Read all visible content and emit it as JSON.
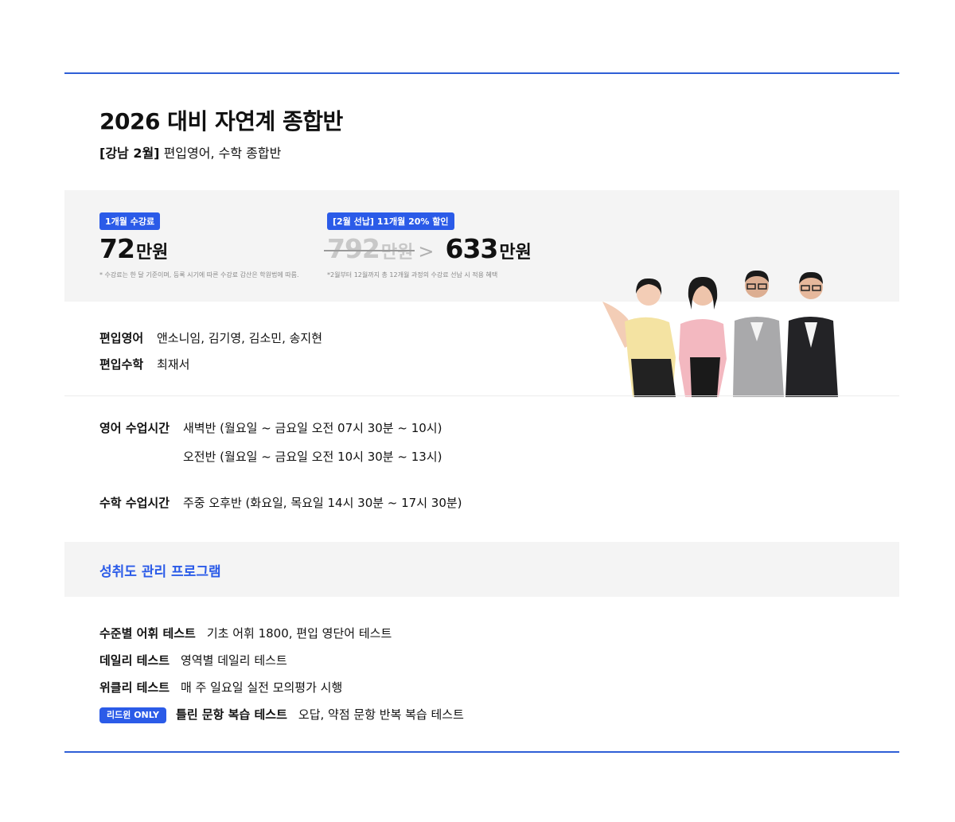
{
  "course": {
    "title": "2026 대비 자연계 종합반",
    "subtitle_prefix": "[강남 2월]",
    "subtitle_rest": " 편입영어, 수학 종합반"
  },
  "price": {
    "monthly": {
      "badge": "1개월 수강료",
      "amount": "72",
      "unit": "만원",
      "note": "* 수강료는 한 달 기준이며, 등록 시기에 따른 수강료 감산은 학원법에 따름."
    },
    "prepay": {
      "badge": "[2월 선납] 11개월 20% 할인",
      "original_amount": "792",
      "original_unit": "만원",
      "arrow": ">",
      "amount": "633",
      "unit": "만원",
      "note": "*2월부터 12월까지 총 12개월 과정의 수강료 선납 시 적용 혜택"
    }
  },
  "teachers": [
    {
      "label": "편입영어",
      "names": "앤소니임, 김기영, 김소민, 송지현"
    },
    {
      "label": "편입수학",
      "names": "최재서"
    }
  ],
  "schedule": {
    "english_label": "영어 수업시간",
    "english_lines": [
      "새벽반 (월요일 ~ 금요일 오전 07시 30분 ~ 10시)",
      "오전반 (월요일 ~ 금요일 오전 10시 30분 ~ 13시)"
    ],
    "math_label": "수학 수업시간",
    "math_line": "주중 오후반 (화요일, 목요일 14시 30분 ~ 17시 30분)"
  },
  "management": {
    "title": "성취도 관리 프로그램",
    "tests": [
      {
        "label": "수준별 어휘 테스트",
        "desc": "기초 어휘 1800, 편입 영단어 테스트"
      },
      {
        "label": "데일리 테스트",
        "desc": "영역별 데일리 테스트"
      },
      {
        "label": "위클리 테스트",
        "desc": "매 주 일요일 실전 모의평가 시행"
      },
      {
        "badge": "리드윈 ONLY",
        "label": "틀린 문항 복습 테스트",
        "desc": "오답, 약점 문항 반복 복습 테스트"
      }
    ]
  },
  "colors": {
    "accent": "#2b5be8",
    "rule": "#2f5fd6",
    "band": "#f4f4f4"
  }
}
